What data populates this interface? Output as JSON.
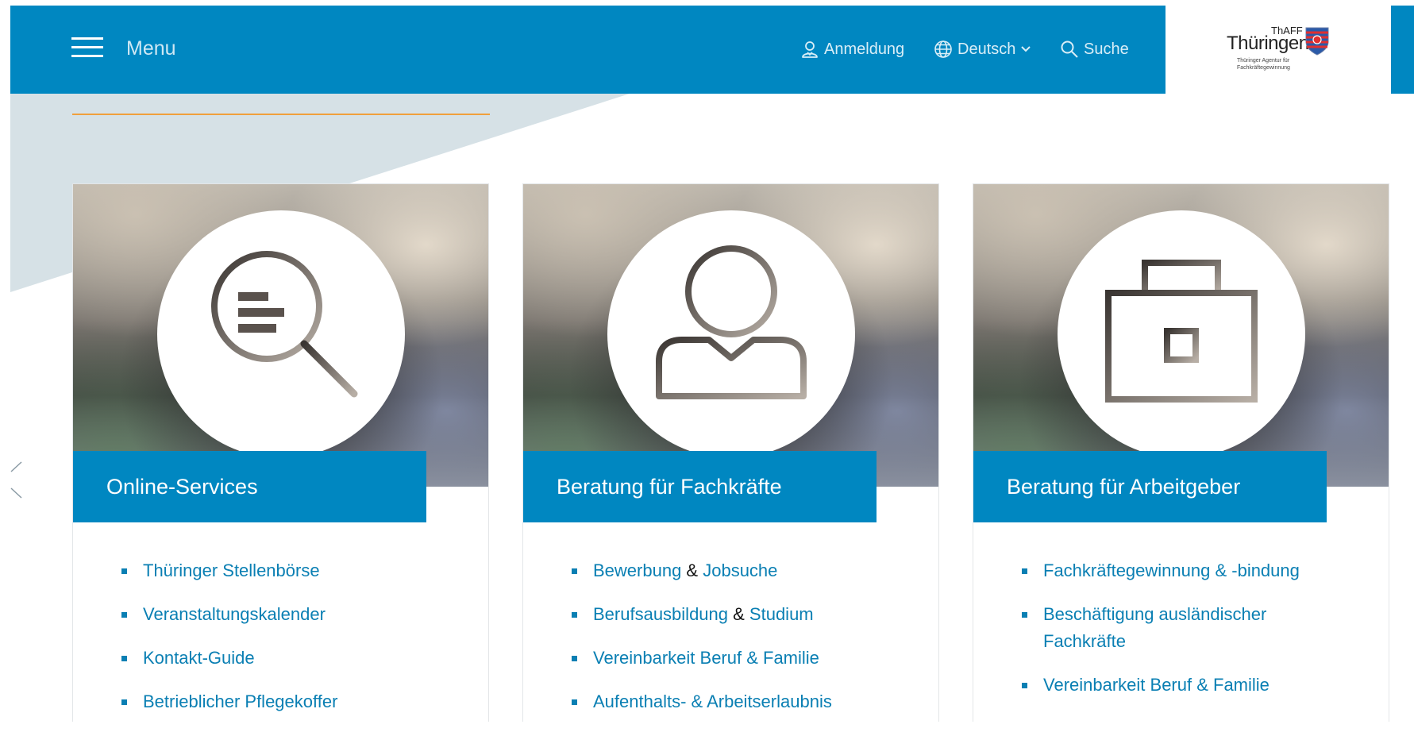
{
  "header": {
    "menu_label": "Menu",
    "login_label": "Anmeldung",
    "language_label": "Deutsch",
    "search_label": "Suche"
  },
  "logo": {
    "top_text": "ThAFF",
    "main_text": "Thüringen",
    "subtitle_line1": "Thüringer Agentur für",
    "subtitle_line2": "Fachkräftegewinnung"
  },
  "cards": [
    {
      "title": "Online-Services",
      "icon": "magnifier-icon",
      "links": [
        {
          "text": "Thüringer Stellenbörse"
        },
        {
          "text": "Veranstaltungskalender"
        },
        {
          "text": "Kontakt-Guide"
        },
        {
          "text": "Betrieblicher Pflegekoffer"
        }
      ]
    },
    {
      "title": "Beratung für Fachkräfte",
      "icon": "person-icon",
      "links": [
        {
          "a": "Bewerbung",
          "amp": " & ",
          "b": "Jobsuche"
        },
        {
          "a": "Berufsausbildung",
          "amp": " & ",
          "b": "Studium"
        },
        {
          "text": "Vereinbarkeit Beruf & Familie"
        },
        {
          "text": "Aufenthalts- & Arbeitserlaubnis"
        }
      ]
    },
    {
      "title": "Beratung für Arbeitgeber",
      "icon": "briefcase-icon",
      "links": [
        {
          "text": "Fachkräftegewinnung & -bindung"
        },
        {
          "line1": "Beschäftigung ausländischer",
          "line2": "Fachkräfte"
        },
        {
          "text": "Vereinbarkeit Beruf & Familie"
        }
      ]
    }
  ],
  "colors": {
    "header_blue": "#0087c1",
    "link_blue": "#0a7fb3",
    "accent_orange": "#f0a03c",
    "triangle_grey": "#d6e1e6"
  }
}
